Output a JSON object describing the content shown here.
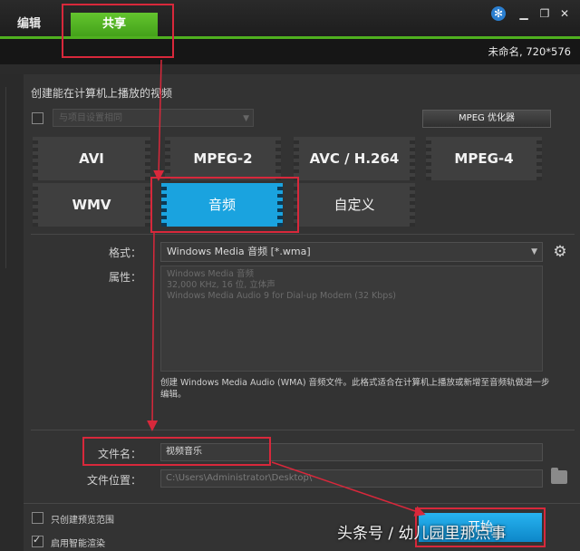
{
  "tabs": {
    "edit": "编辑",
    "share": "共享"
  },
  "project_info": "未命名, 720*576",
  "section_title": "创建能在计算机上播放的视频",
  "preset_dropdown": "与项目设置相同",
  "mpeg_optimizer": "MPEG 优化器",
  "formats": [
    {
      "label": "AVI",
      "active": false
    },
    {
      "label": "MPEG-2",
      "active": false
    },
    {
      "label": "AVC / H.264",
      "active": false
    },
    {
      "label": "MPEG-4",
      "active": false
    },
    {
      "label": "WMV",
      "active": false
    },
    {
      "label": "音频",
      "active": true
    },
    {
      "label": "自定义",
      "active": false
    }
  ],
  "format_label": "格式：",
  "format_value": "Windows Media 音频 [*.wma]",
  "properties_label": "属性：",
  "properties_lines": [
    "Windows Media 音频",
    "32,000 KHz, 16 位, 立体声",
    "Windows Media Audio 9 for Dial-up Modem (32 Kbps)"
  ],
  "description": "创建 Windows Media Audio (WMA) 音频文件。此格式适合在计算机上播放或新增至音频轨做进一步编辑。",
  "filename_label": "文件名：",
  "filename_value": "视频音乐",
  "location_label": "文件位置：",
  "location_value": "C:\\Users\\Administrator\\Desktop\\",
  "option_preview_range": "只创建预览范围",
  "option_smart_render": "启用智能渲染",
  "start_button": "开始",
  "watermark": "头条号 / 幼儿园里那点事",
  "colors": {
    "accent_green": "#4fb01f",
    "active_blue": "#1aa3df",
    "annotation_red": "#d8283b"
  }
}
